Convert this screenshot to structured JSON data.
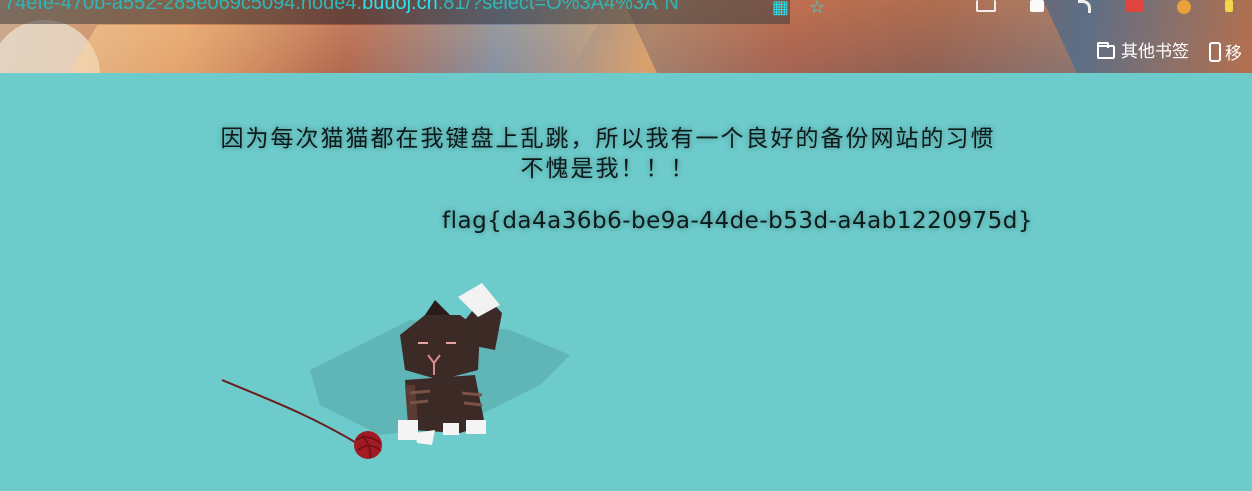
{
  "browser": {
    "address": "74efe-470b-a552-285e069c5094.node4.",
    "address_host": "buuoj.cn",
    "address_rest": ":81/?select=O%3A4%3A\"N",
    "bookmark_folder": "其他书签",
    "bookmark_mobile": "移",
    "icons": [
      "qr-code-icon",
      "star-icon",
      "download-icon",
      "extension-icon",
      "arrow-icon",
      "red-extension-icon",
      "orange-extension-icon",
      "yellow-extension-icon",
      "folder-icon",
      "phone-icon"
    ]
  },
  "page": {
    "message_line1": "因为每次猫猫都在我键盘上乱跳，所以我有一个良好的备份网站的习惯",
    "message_line2": "不愧是我！！！",
    "flag": "flag{da4a36b6-be9a-44de-b53d-a4ab1220975d}"
  },
  "colors": {
    "page_background": "#6dcbcb",
    "text": "#0c1a1a",
    "address_host": "#2fe0ea",
    "cat_body": "#3b2a26",
    "yarn": "#a11a24"
  }
}
